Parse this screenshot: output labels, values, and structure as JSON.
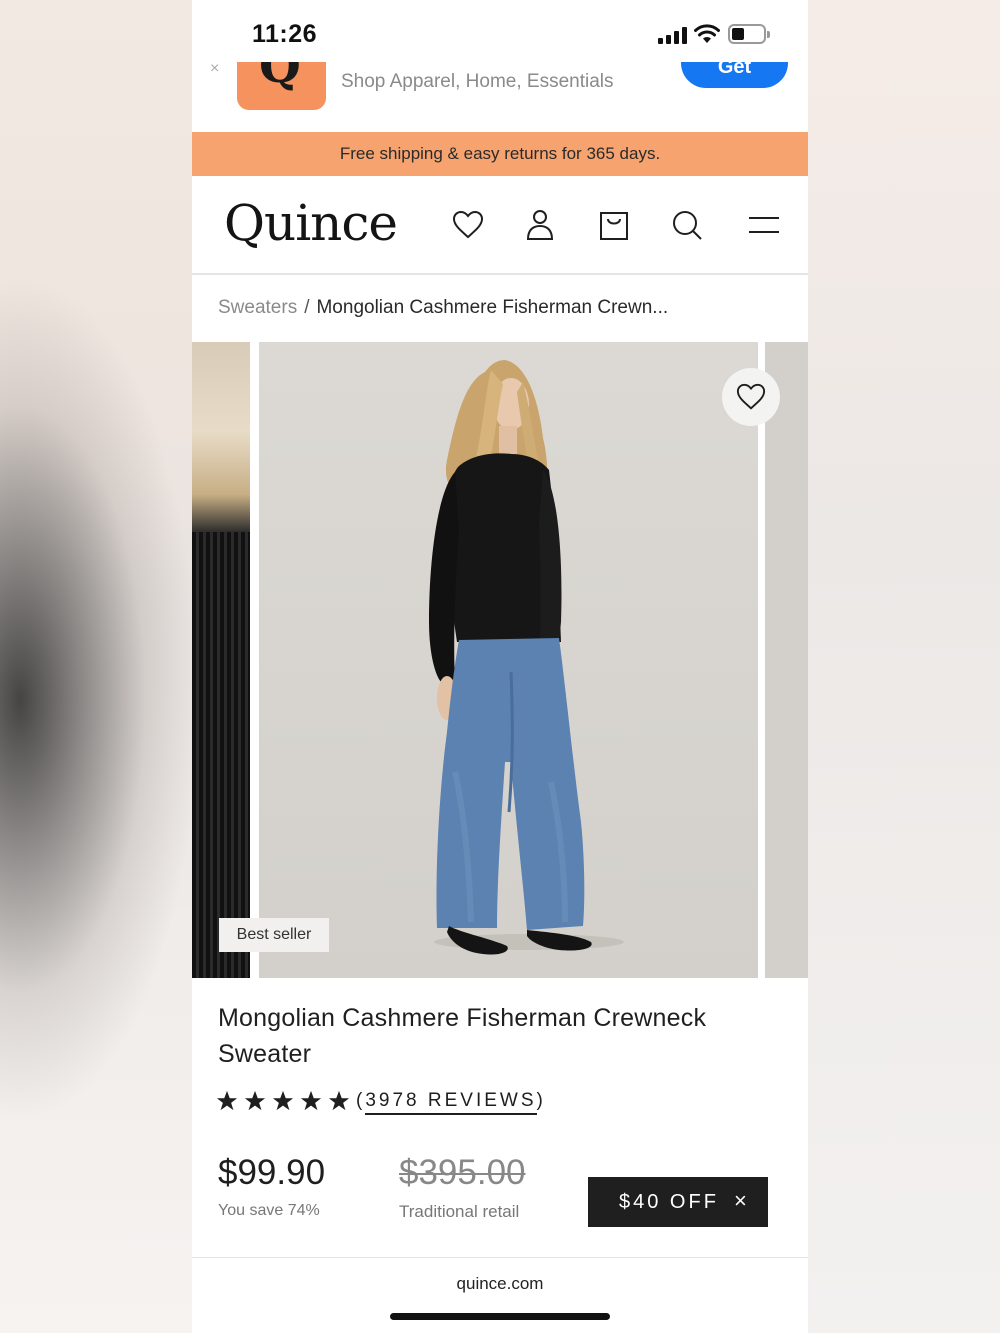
{
  "status_bar": {
    "time": "11:26"
  },
  "app_banner": {
    "close_symbol": "×",
    "icon_letter": "Q",
    "tagline": "Shop Apparel, Home, Essentials",
    "get_label": "Get"
  },
  "promo": {
    "text": "Free shipping & easy returns for 365 days."
  },
  "header": {
    "logo": "Quince",
    "icons": [
      "heart-icon",
      "account-icon",
      "bag-icon",
      "search-icon",
      "menu-icon"
    ]
  },
  "breadcrumb": {
    "category": "Sweaters",
    "separator": "/",
    "current": "Mongolian Cashmere Fisherman Crewn..."
  },
  "gallery": {
    "badge": "Best seller"
  },
  "product": {
    "title": "Mongolian Cashmere Fisherman Crewneck Sweater",
    "rating": 5,
    "reviews_open": "(",
    "reviews_label": "3978 REVIEWS",
    "reviews_close": ")",
    "price": "$99.90",
    "savings": "You save 74%",
    "original_price": "$395.00",
    "original_label": "Traditional retail",
    "discount_label": "$40 OFF",
    "discount_close": "×"
  },
  "browser": {
    "url": "quince.com"
  },
  "colors": {
    "promo_bg": "#f6a36f",
    "get_button": "#1677f2",
    "dark": "#1f1f1f"
  }
}
